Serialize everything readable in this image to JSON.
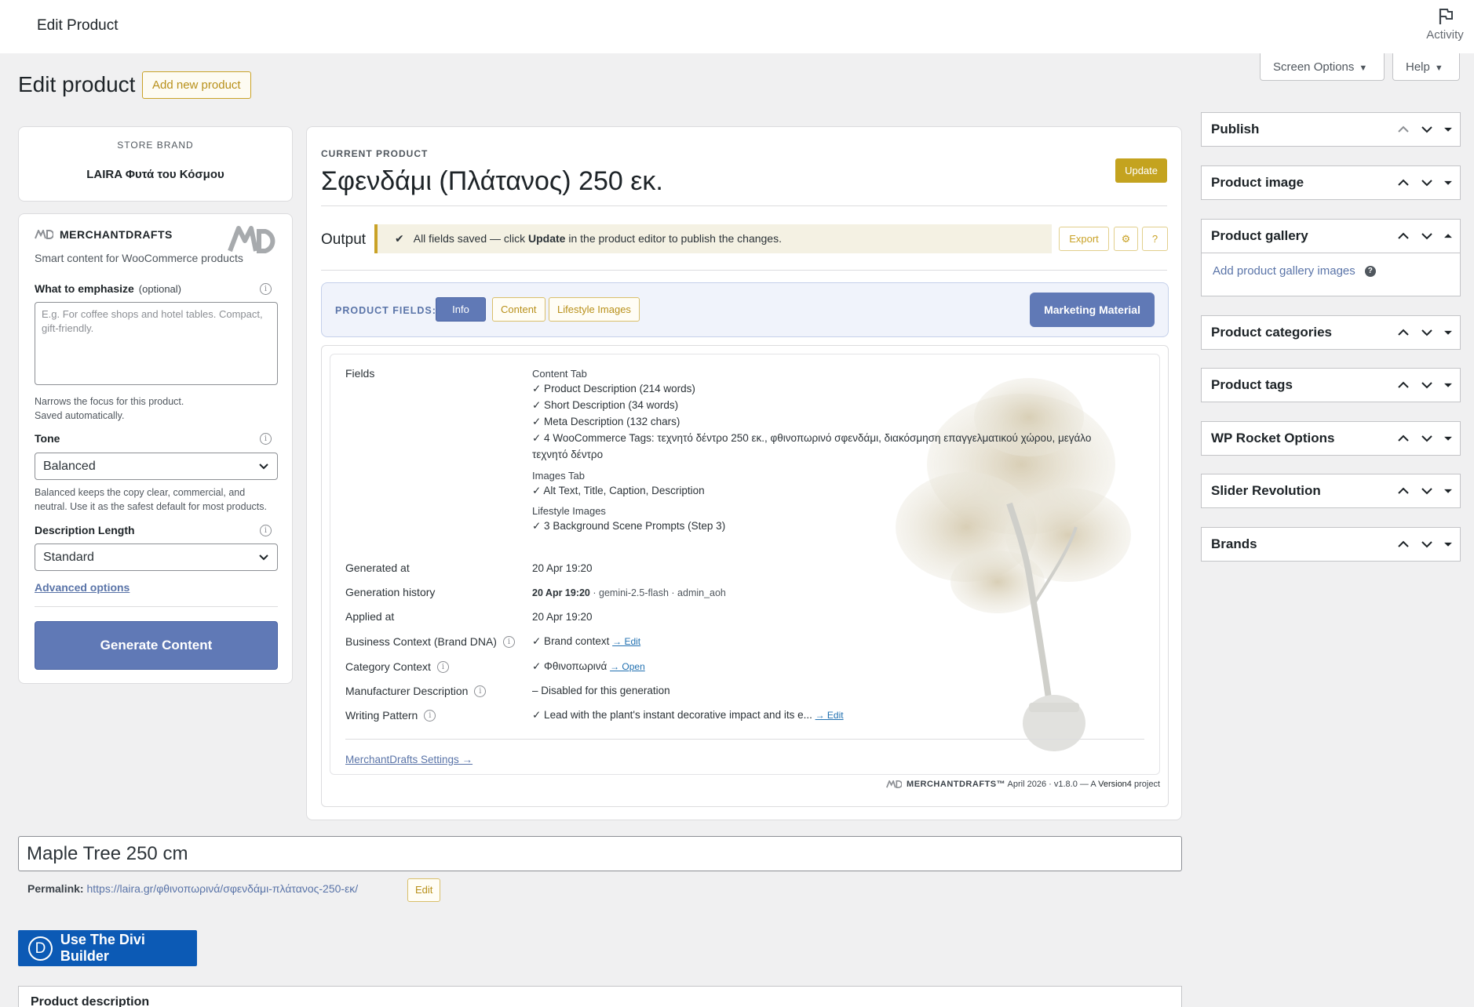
{
  "topbar": {
    "title": "Edit Product",
    "activity": "Activity"
  },
  "screen_options": {
    "label": "Screen Options",
    "help": "Help"
  },
  "page": {
    "heading": "Edit product",
    "add_new": "Add new product"
  },
  "store_brand": {
    "label": "STORE BRAND",
    "name": "LAIRA Φυτά του Κόσμου"
  },
  "merchantdrafts": {
    "title": "MERCHANTDRAFTS",
    "subtitle": "Smart content for WooCommerce products",
    "emphasize_label": "What to emphasize",
    "emphasize_optional": "(optional)",
    "emphasize_placeholder": "E.g. For coffee shops and hotel tables. Compact, gift-friendly.",
    "emphasize_hint_1": "Narrows the focus for this product.",
    "emphasize_hint_2": "Saved automatically.",
    "tone_label": "Tone",
    "tone_value": "Balanced",
    "tone_hint_1": "Balanced keeps the copy clear, commercial, and",
    "tone_hint_2": "neutral. Use it as the safest default for most products.",
    "length_label": "Description Length",
    "length_value": "Standard",
    "advanced": "Advanced options",
    "generate": "Generate Content"
  },
  "current": {
    "label": "CURRENT PRODUCT",
    "title": "Σφενδάμι (Πλάτανος) 250 εκ.",
    "update": "Update",
    "output_label": "Output",
    "notice_pre": "All fields saved — click ",
    "notice_bold": "Update",
    "notice_post": " in the product editor to publish the changes.",
    "export": "Export",
    "gear": "⚙",
    "question": "?"
  },
  "product_fields": {
    "label": "PRODUCT FIELDS:",
    "tabs": [
      "Info",
      "Content",
      "Lifestyle Images"
    ],
    "marketing": "Marketing Material"
  },
  "fields": {
    "fields_label": "Fields",
    "content_tab": "Content Tab",
    "content_items": [
      "✓ Product Description (214 words)",
      "✓ Short Description (34 words)",
      "✓ Meta Description (132 chars)",
      "✓ 4 WooCommerce Tags: τεχνητό δέντρο 250 εκ., φθινοπωρινό σφενδάμι, διακόσμηση επαγγελματικού χώρου, μεγάλο",
      "τεχνητό δέντρο"
    ],
    "images_tab": "Images Tab",
    "images_item": "✓ Alt Text, Title, Caption, Description",
    "lifestyle_tab": "Lifestyle Images",
    "lifestyle_item": "✓ 3 Background Scene Prompts (Step 3)",
    "generated_at_label": "Generated at",
    "generated_at": "20 Apr 19:20",
    "history_label": "Generation history",
    "history_date": "20 Apr 19:20",
    "history_meta": " · gemini-2.5-flash · admin_aoh",
    "applied_label": "Applied at",
    "applied_at": "20 Apr 19:20",
    "business_label": "Business Context (Brand DNA)",
    "business_value": "✓ Brand context ",
    "business_link": "→ Edit",
    "category_label": "Category Context",
    "category_value": "✓ Φθινοπωρινά ",
    "category_link": "→ Open",
    "manufacturer_label": "Manufacturer Description",
    "manufacturer_value": "– Disabled for this generation",
    "writing_label": "Writing Pattern",
    "writing_value": "✓ Lead with the plant's instant decorative impact and its e... ",
    "writing_link": "→ Edit",
    "settings_link": "MerchantDrafts Settings →",
    "footer_brand": "MERCHANTDRAFTS™",
    "footer_text": " April 2026 · v1.8.0 — A ",
    "footer_link": "Version4",
    "footer_end": " project"
  },
  "sidebar": {
    "boxes": [
      "Publish",
      "Product image",
      "Product gallery",
      "Product categories",
      "Product tags",
      "WP Rocket Options",
      "Slider Revolution",
      "Brands"
    ],
    "gallery_link": "Add product gallery images"
  },
  "product_title": "Maple Tree 250 cm",
  "permalink": {
    "label": "Permalink:",
    "url": "https://laira.gr/φθινοπωρινά/σφενδάμι-πλάτανος-250-εκ/",
    "edit": "Edit"
  },
  "divi": {
    "letter": "D",
    "label": "Use The Divi Builder"
  },
  "description_box": "Product description"
}
